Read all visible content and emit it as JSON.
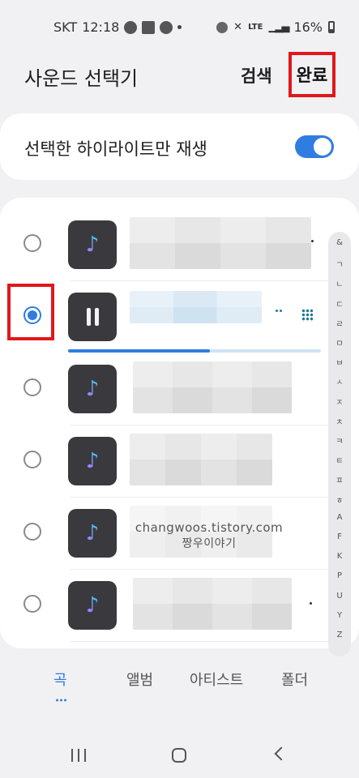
{
  "status_bar": {
    "carrier": "SKT",
    "time": "12:18",
    "network": "LTE",
    "battery": "16%"
  },
  "header": {
    "title": "사운드 선택기",
    "search_label": "검색",
    "done_label": "완료"
  },
  "highlight_toggle": {
    "label": "선택한 하이라이트만 재생",
    "enabled": true
  },
  "songs": {
    "items": [
      {
        "selected": false,
        "playing": false
      },
      {
        "selected": true,
        "playing": true,
        "progress": 0.56
      },
      {
        "selected": false,
        "playing": false
      },
      {
        "selected": false,
        "playing": false
      },
      {
        "selected": false,
        "playing": false
      },
      {
        "selected": false,
        "playing": false
      },
      {
        "selected": false,
        "playing": false
      }
    ],
    "icon": "music-note-icon"
  },
  "index_bar": {
    "letters": [
      "&",
      "ㄱ",
      "ㄴ",
      "ㄷ",
      "ㄹ",
      "ㅁ",
      "ㅂ",
      "ㅅ",
      "ㅈ",
      "ㅊ",
      "ㅋ",
      "ㅌ",
      "ㅍ",
      "ㅎ",
      "A",
      "F",
      "K",
      "P",
      "U",
      "Y",
      "Z"
    ]
  },
  "watermark": {
    "line1": "changwoos.tistory.com",
    "line2": "짱우이야기"
  },
  "tabs": {
    "items": [
      "곡",
      "앨범",
      "아티스트",
      "폴더"
    ],
    "active": 0
  },
  "colors": {
    "accent": "#2f7de1",
    "highlight_box": "#e0181b"
  }
}
